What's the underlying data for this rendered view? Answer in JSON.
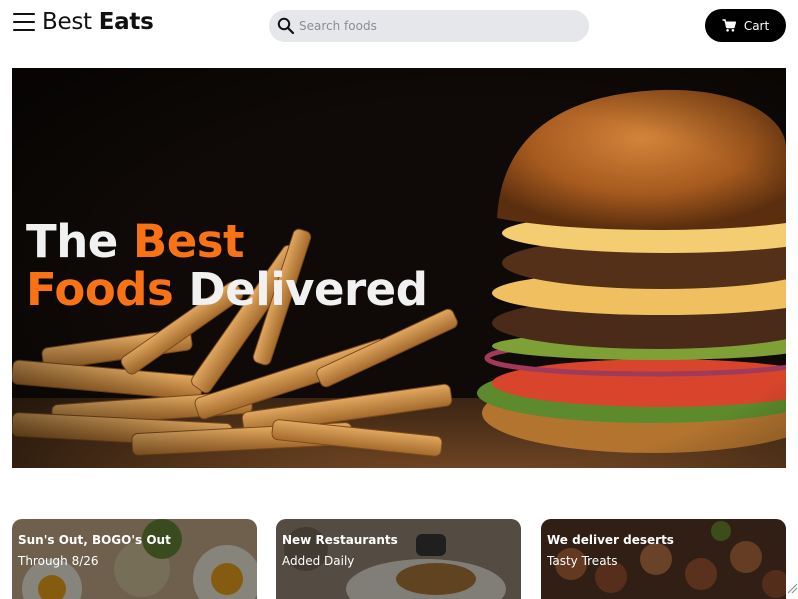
{
  "header": {
    "menu_icon": "hamburger-menu-icon",
    "logo": {
      "part1": "Best ",
      "part2": "Eats"
    },
    "search": {
      "placeholder": "Search foods",
      "icon": "search-icon"
    },
    "cart": {
      "label": "Cart",
      "icon": "shopping-cart-icon"
    }
  },
  "hero": {
    "title_word1": "The ",
    "title_word2": "Best",
    "title_word3": "Foods",
    "title_word4": " Delivered",
    "image": "burger-and-fries-photo",
    "accent_color": "#f97316"
  },
  "cards": [
    {
      "title": "Sun's Out, BOGO's Out",
      "subtitle": "Through 8/26",
      "image": "eggs-salad-photo"
    },
    {
      "title": "New Restaurants",
      "subtitle": "Added Daily",
      "image": "restaurant-plates-photo"
    },
    {
      "title": "We deliver deserts",
      "subtitle": "Tasty Treats",
      "image": "grilled-skewers-photo"
    }
  ]
}
